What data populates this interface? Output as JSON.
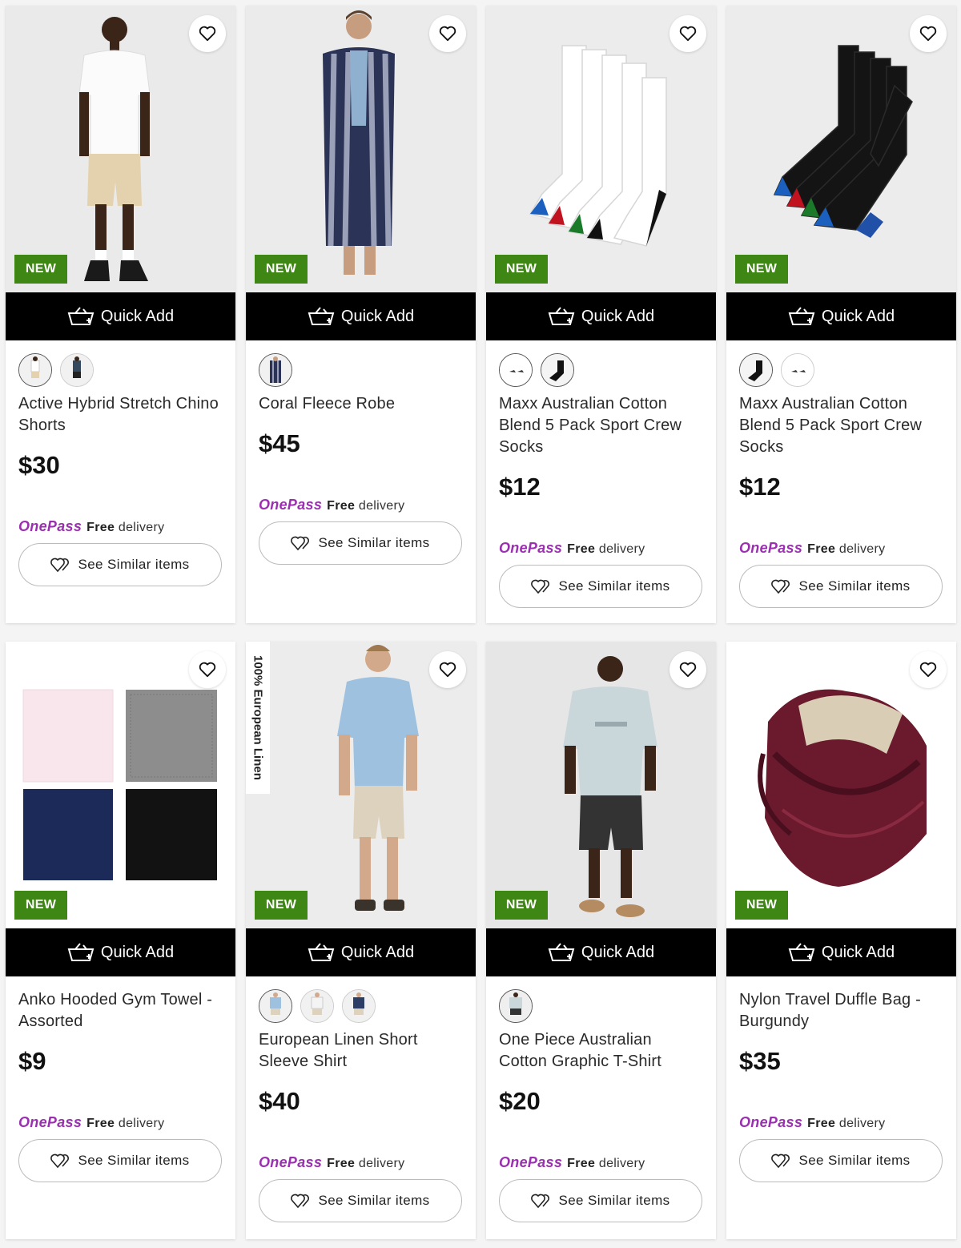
{
  "labels": {
    "new_badge": "NEW",
    "quick_add": "Quick Add",
    "onepass_logo": "OnePass",
    "onepass_free": "Free",
    "onepass_delivery": "delivery",
    "see_similar": "See Similar items"
  },
  "colors": {
    "new_badge": "#3e8714",
    "onepass": "#9a2fb0",
    "quick_add_bg": "#000000"
  },
  "products": [
    {
      "title": "Active Hybrid Stretch Chino Shorts",
      "price": "$30",
      "image": "man-white-tee-beige-shorts",
      "swatch_count": 2
    },
    {
      "title": "Coral Fleece Robe",
      "price": "$45",
      "image": "man-striped-robe",
      "swatch_count": 1
    },
    {
      "title": "Maxx Australian Cotton Blend 5 Pack Sport Crew Socks",
      "price": "$12",
      "image": "white-socks-pack",
      "swatch_count": 2
    },
    {
      "title": "Maxx Australian Cotton Blend 5 Pack Sport Crew Socks",
      "price": "$12",
      "image": "black-socks-pack",
      "swatch_count": 2
    },
    {
      "title": "Anko Hooded Gym Towel - Assorted",
      "price": "$9",
      "image": "four-towels",
      "swatch_count": 0
    },
    {
      "title": "European Linen Short Sleeve Shirt",
      "price": "$40",
      "image": "man-blue-linen-shirt",
      "swatch_count": 3,
      "side_label": "100% European Linen"
    },
    {
      "title": "One Piece Australian Cotton Graphic T-Shirt",
      "price": "$20",
      "image": "man-grey-graphic-tee",
      "swatch_count": 1
    },
    {
      "title": "Nylon Travel Duffle Bag - Burgundy",
      "price": "$35",
      "image": "burgundy-duffle-bag",
      "swatch_count": 0
    }
  ]
}
